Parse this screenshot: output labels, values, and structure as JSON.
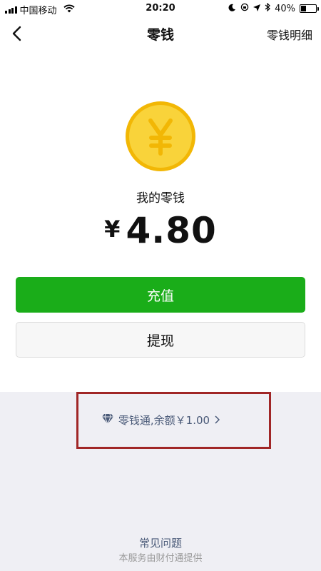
{
  "status_bar": {
    "carrier": "中国移动",
    "time": "20:20",
    "battery_percent": "40%",
    "battery_level": 0.4
  },
  "nav": {
    "title": "零钱",
    "right_link": "零钱明细"
  },
  "wallet": {
    "label": "我的零钱",
    "currency_symbol": "¥",
    "amount": "4.80"
  },
  "buttons": {
    "recharge": "充值",
    "withdraw": "提现"
  },
  "lingqiantong": {
    "text": "零钱通,余额￥1.00"
  },
  "footer": {
    "faq": "常见问题",
    "provider": "本服务由财付通提供"
  },
  "colors": {
    "primary_green": "#1aad19",
    "coin_gold": "#f5c518",
    "link_blue": "#4a5a78",
    "highlight_red": "#a02626"
  }
}
